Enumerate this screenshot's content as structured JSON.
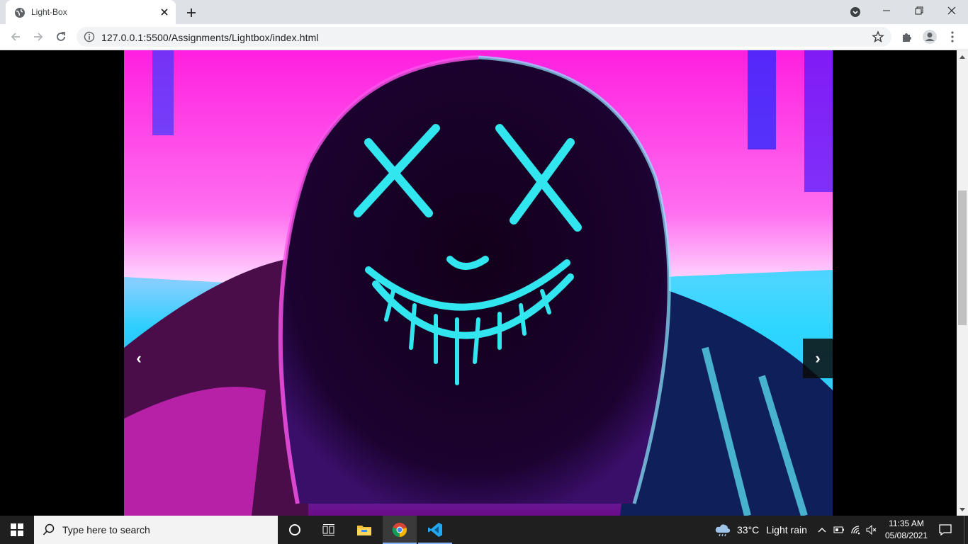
{
  "browser": {
    "tab_title": "Light-Box",
    "url": "127.0.0.1:5500/Assignments/Lightbox/index.html"
  },
  "lightbox": {
    "prev_label": "‹",
    "next_label": "›"
  },
  "taskbar": {
    "search_placeholder": "Type here to search",
    "weather_temp": "33°C",
    "weather_desc": "Light rain",
    "time": "11:35 AM",
    "date": "05/08/2021"
  },
  "colors": {
    "tabstrip": "#dee1e6",
    "neon_cyan": "#32e6f0",
    "neon_magenta": "#ff2ee6",
    "taskbar": "#1f1f1f"
  },
  "icons": {
    "favicon": "globe-icon",
    "tab_close": "close-icon",
    "new_tab": "plus-icon",
    "back": "back-arrow-icon",
    "forward": "forward-arrow-icon",
    "reload": "reload-icon",
    "bookmark": "star-icon",
    "extensions": "puzzle-icon",
    "profile": "profile-icon",
    "menu": "kebab-menu-icon"
  }
}
